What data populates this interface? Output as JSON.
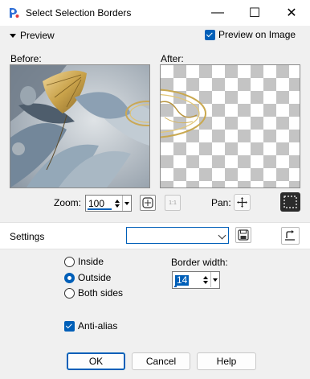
{
  "window": {
    "title": "Select Selection Borders",
    "controls": {
      "minimize": "—",
      "maximize": "☐",
      "close": "✕"
    }
  },
  "preview": {
    "toggle_label": "Preview",
    "preview_on_image_label": "Preview on Image",
    "preview_on_image_checked": true,
    "before_label": "Before:",
    "after_label": "After:"
  },
  "zoom": {
    "label": "Zoom:",
    "value": "100",
    "actual_size_icon_text": "1:1"
  },
  "pan": {
    "label": "Pan:"
  },
  "settings": {
    "label": "Settings",
    "preset_value": ""
  },
  "border_mode": {
    "options": [
      {
        "label": "Inside",
        "selected": false
      },
      {
        "label": "Outside",
        "selected": true
      },
      {
        "label": "Both sides",
        "selected": false
      }
    ]
  },
  "border_width": {
    "label": "Border width:",
    "value": "14"
  },
  "anti_alias": {
    "label": "Anti-alias",
    "checked": true
  },
  "buttons": {
    "ok": "OK",
    "cancel": "Cancel",
    "help": "Help"
  },
  "colors": {
    "accent": "#005fb8",
    "checker_light": "#ffffff",
    "checker_dark": "#c4c4c4",
    "leaf_gold": "#c9a24a",
    "leaf_blue": "#7f95a8"
  },
  "icons": [
    "app-icon",
    "chevron-down-icon",
    "fit-window-icon",
    "actual-size-icon",
    "pan-cross-icon",
    "marquee-icon",
    "save-preset-icon",
    "reset-default-icon"
  ]
}
